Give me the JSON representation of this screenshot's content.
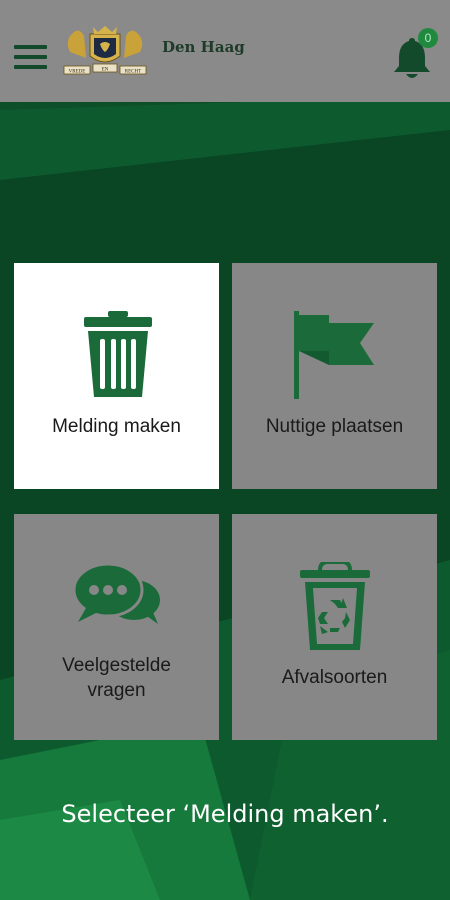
{
  "header": {
    "menu_icon": "hamburger-menu-icon",
    "city_name": "Den Haag",
    "notification_icon": "bell-icon",
    "notification_count": "0",
    "crest_banner_left": "VREDE",
    "crest_banner_mid": "EN",
    "crest_banner_right": "RECHT"
  },
  "tiles": [
    {
      "label": "Melding maken",
      "icon": "trash-bin-icon",
      "selected": true
    },
    {
      "label": "Nuttige plaatsen",
      "icon": "flag-icon",
      "selected": false
    },
    {
      "label_line1": "Veelgestelde",
      "label_line2": "vragen",
      "icon": "chat-bubbles-icon",
      "selected": false
    },
    {
      "label": "Afvalsoorten",
      "icon": "recycle-bin-icon",
      "selected": false
    }
  ],
  "instruction": "Selecteer ‘Melding maken’.",
  "colors": {
    "brand_green": "#1b6b3a",
    "background_green": "#0b4a26",
    "header_grey": "#8a8a8a",
    "tile_grey": "#878787",
    "badge_green": "#1f8a3e"
  }
}
